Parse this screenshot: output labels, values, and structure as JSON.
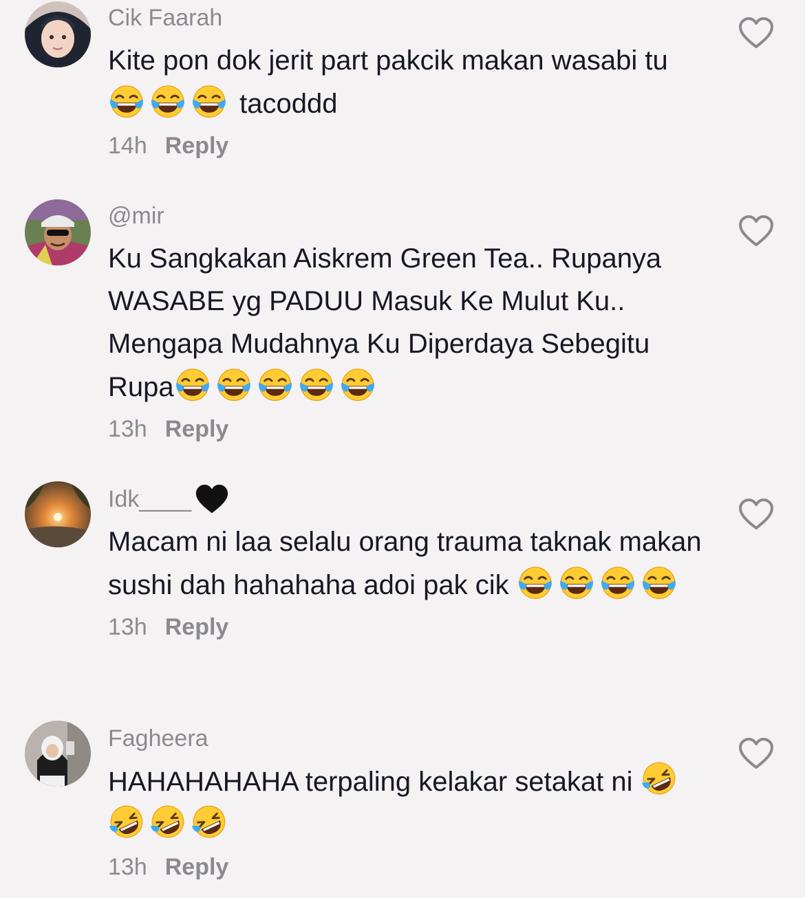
{
  "comments": [
    {
      "username": "Cik Faarah",
      "text_parts": [
        "Kite pon dok jerit part pakcik makan wasabi tu ",
        "😂😂😂",
        " tacoddd"
      ],
      "time": "14h",
      "reply_label": "Reply",
      "avatar": "avatar-hijab-woman",
      "like_icon": "heart-outline-icon"
    },
    {
      "username": "@mir",
      "text_parts": [
        "Ku Sangkakan Aiskrem Green Tea.. Rupanya WASABE yg PADUU Masuk Ke Mulut Ku.. Mengapa Mudahnya Ku Diperdaya Sebegitu Rupa",
        "😂😂😂😂😂"
      ],
      "time": "13h",
      "reply_label": "Reply",
      "avatar": "avatar-man-cap-sunglasses",
      "like_icon": "heart-outline-icon"
    },
    {
      "username": "Idk____",
      "username_emoji": "🖤",
      "text_parts": [
        "Macam ni laa selalu orang trauma taknak makan sushi dah hahahaha adoi pak cik ",
        "😂😂😂😂"
      ],
      "time": "13h",
      "reply_label": "Reply",
      "avatar": "avatar-sunset",
      "like_icon": "heart-outline-icon"
    },
    {
      "username": "Fagheera",
      "text_parts": [
        "HAHAHAHAHA terpaling kelakar setakat ni ",
        "🤣🤣🤣🤣"
      ],
      "time": "13h",
      "reply_label": "Reply",
      "avatar": "avatar-hijab-selfie",
      "like_icon": "heart-outline-icon"
    }
  ],
  "colors": {
    "background": "#f4f2f3",
    "username": "#8a8a8e",
    "text": "#161823",
    "emoji_face": "#ffcc33",
    "tear": "#3fa9f5"
  }
}
